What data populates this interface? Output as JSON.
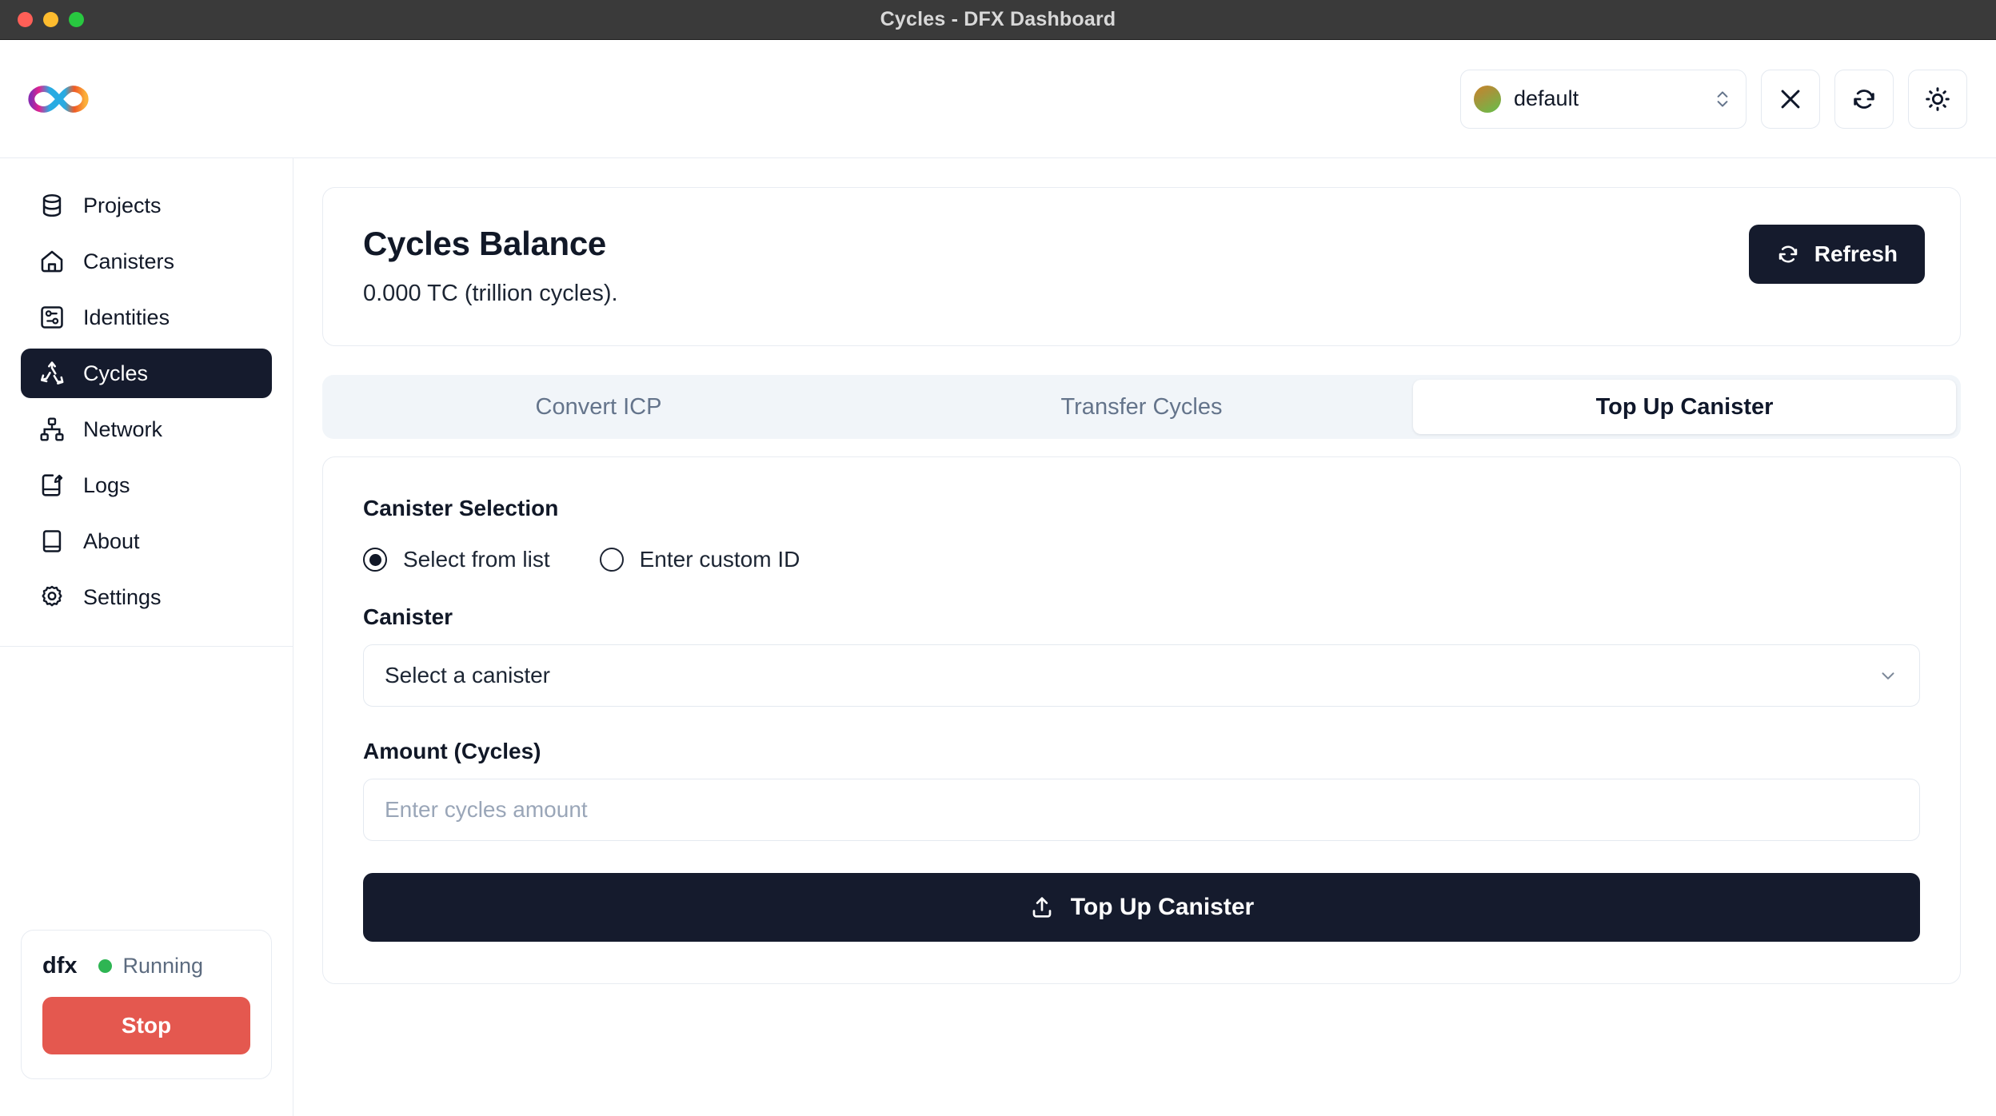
{
  "window": {
    "title": "Cycles - DFX Dashboard",
    "traffic_lights": [
      "close",
      "minimize",
      "maximize"
    ]
  },
  "header": {
    "logo_name": "internet-computer-infinity-logo",
    "identity": {
      "value": "default",
      "chevron_icon": "chevron-up-down-icon"
    },
    "buttons": [
      {
        "name": "close-icon",
        "label": "X"
      },
      {
        "name": "refresh-icon",
        "label": "Refresh"
      },
      {
        "name": "theme-toggle-sun-icon",
        "label": "Theme"
      }
    ]
  },
  "sidebar": {
    "items": [
      {
        "label": "Projects",
        "icon": "database-icon",
        "active": false
      },
      {
        "label": "Canisters",
        "icon": "home-icon",
        "active": false
      },
      {
        "label": "Identities",
        "icon": "identity-card-icon",
        "active": false
      },
      {
        "label": "Cycles",
        "icon": "recycle-icon",
        "active": true
      },
      {
        "label": "Network",
        "icon": "network-nodes-icon",
        "active": false
      },
      {
        "label": "Logs",
        "icon": "notebook-pen-icon",
        "active": false
      },
      {
        "label": "About",
        "icon": "book-icon",
        "active": false
      },
      {
        "label": "Settings",
        "icon": "gear-icon",
        "active": false
      }
    ],
    "dfx": {
      "name": "dfx",
      "status": "Running",
      "status_color": "#2eb553",
      "stop_label": "Stop"
    }
  },
  "main": {
    "balance": {
      "title": "Cycles Balance",
      "value": "0.000 TC (trillion cycles).",
      "refresh_label": "Refresh"
    },
    "tabs": [
      {
        "label": "Convert ICP",
        "active": false
      },
      {
        "label": "Transfer Cycles",
        "active": false
      },
      {
        "label": "Top Up Canister",
        "active": true
      }
    ],
    "form": {
      "selection_label": "Canister Selection",
      "radios": [
        {
          "label": "Select from list",
          "checked": true
        },
        {
          "label": "Enter custom ID",
          "checked": false
        }
      ],
      "canister_label": "Canister",
      "canister_value": "Select a canister",
      "amount_label": "Amount (Cycles)",
      "amount_value": "",
      "amount_placeholder": "Enter cycles amount",
      "submit_label": "Top Up Canister"
    }
  },
  "colors": {
    "accent_dark": "#151b2d",
    "danger": "#e4584f",
    "success": "#2eb553",
    "tab_bg": "#f1f5f9",
    "border": "#e8ecf2"
  }
}
